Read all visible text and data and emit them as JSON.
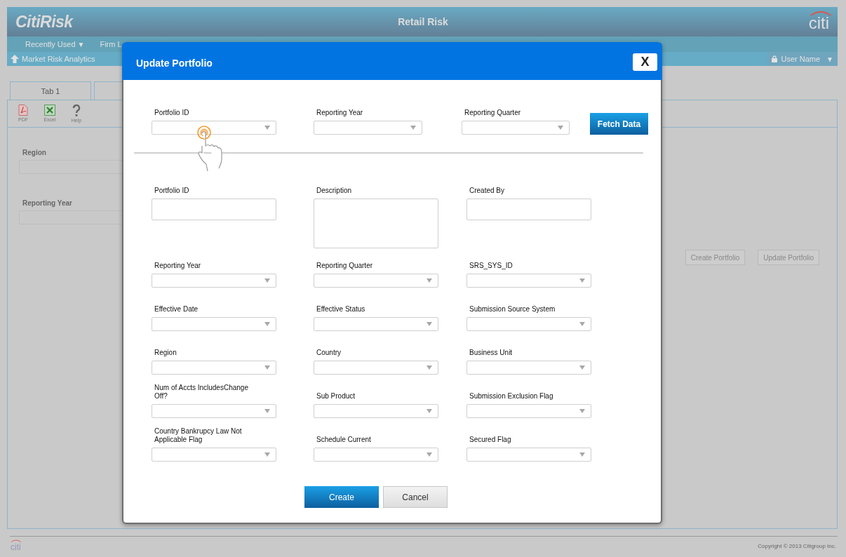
{
  "app": {
    "logo": "CitiRisk",
    "title": "Retail Risk",
    "brand": "citi"
  },
  "nav": [
    {
      "label": "Recently Used",
      "caret": "▼"
    },
    {
      "label": "Firm L"
    }
  ],
  "breadcrumb": "Market Risk Analytics",
  "user": {
    "name": "User Name",
    "caret": "▼"
  },
  "tabs": [
    {
      "kind": "labeled",
      "label": "Tab 1"
    },
    {
      "kind": "blank"
    }
  ],
  "toolbar": [
    {
      "kind": "pdf",
      "label": "PDF"
    },
    {
      "kind": "excel",
      "label": "Excel"
    },
    {
      "kind": "help",
      "label": "Help"
    }
  ],
  "filters": [
    {
      "label": "Region"
    },
    {
      "label": "Reporting Year"
    }
  ],
  "actions": [
    "Create Portfolio",
    "Update Portfolio"
  ],
  "dialog": {
    "title": "Update Portfolio",
    "close": "X",
    "lookup": [
      {
        "label": "Portfolio ID",
        "kind": "select"
      },
      {
        "label": "Reporting Year",
        "kind": "select"
      },
      {
        "label": "Reporting Quarter",
        "kind": "select"
      }
    ],
    "fetch": "Fetch Data",
    "form": [
      [
        {
          "label": "Portfolio ID",
          "kind": "text"
        },
        {
          "label": "Description",
          "kind": "textarea"
        },
        {
          "label": "Created By",
          "kind": "text"
        }
      ],
      [
        {
          "label": "Reporting Year",
          "kind": "select"
        },
        {
          "label": "Reporting Quarter",
          "kind": "select"
        },
        {
          "label": "SRS_SYS_ID",
          "kind": "select"
        }
      ],
      [
        {
          "label": "Effective Date",
          "kind": "select"
        },
        {
          "label": "Effective Status",
          "kind": "select"
        },
        {
          "label": "Submission Source System",
          "kind": "select"
        }
      ],
      [
        {
          "label": "Region",
          "kind": "select"
        },
        {
          "label": "Country",
          "kind": "select"
        },
        {
          "label": "Business Unit",
          "kind": "select"
        }
      ],
      [
        {
          "label": "Num of Accts IncludesChange Off?",
          "kind": "select"
        },
        {
          "label": "Sub Product",
          "kind": "select"
        },
        {
          "label": "Submission Exclusion Flag",
          "kind": "select"
        }
      ],
      [
        {
          "label": "Country Bankrupcy Law Not Applicable Flag",
          "kind": "select"
        },
        {
          "label": "Schedule Current",
          "kind": "select"
        },
        {
          "label": "Secured Flag",
          "kind": "select"
        }
      ]
    ],
    "buttons": [
      {
        "label": "Create",
        "kind": "primary"
      },
      {
        "label": "Cancel",
        "kind": "secondary"
      }
    ]
  },
  "footer": {
    "brand": "citi",
    "copyright": "Copyright © 2013 Citigroup Inc."
  }
}
